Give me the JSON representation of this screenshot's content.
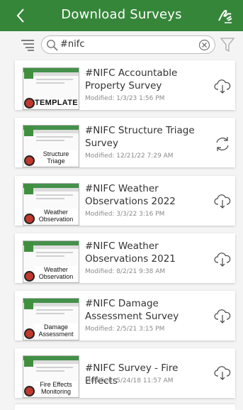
{
  "header": {
    "title": "Download Surveys"
  },
  "search": {
    "query": "#nifc"
  },
  "surveys": [
    {
      "title": "#NIFC Accountable Property Survey",
      "modified": "Modified: 1/3/23 1:56 PM",
      "thumb_label": "TEMPLATE",
      "action": "download"
    },
    {
      "title": "#NIFC Structure Triage Survey",
      "modified": "Modified: 12/21/22 7:29 AM",
      "thumb_label": "Structure Triage",
      "action": "sync"
    },
    {
      "title": "#NIFC Weather Observations 2022",
      "modified": "Modified: 3/3/22 3:16 PM",
      "thumb_label": "Weather Observation",
      "action": "download"
    },
    {
      "title": "#NIFC Weather Observations 2021",
      "modified": "Modified: 8/2/21 9:38 AM",
      "thumb_label": "Weather Observation",
      "action": "download"
    },
    {
      "title": "#NIFC Damage Assessment Survey",
      "modified": "Modified: 2/5/21 3:15 PM",
      "thumb_label": "Damage Assessment",
      "action": "download"
    },
    {
      "title": "#NIFC Survey - Fire Effects",
      "modified": "Modified: 5/24/18 11:57 AM",
      "thumb_label": "Fire Effects Monitoring",
      "action": "download"
    }
  ],
  "colors": {
    "header": "#36863a",
    "background": "#f4f4f4"
  },
  "icons": [
    "back-icon",
    "signature-icon",
    "menu-icon",
    "search-icon",
    "clear-icon",
    "filter-icon",
    "cloud-download-icon",
    "sync-icon"
  ]
}
